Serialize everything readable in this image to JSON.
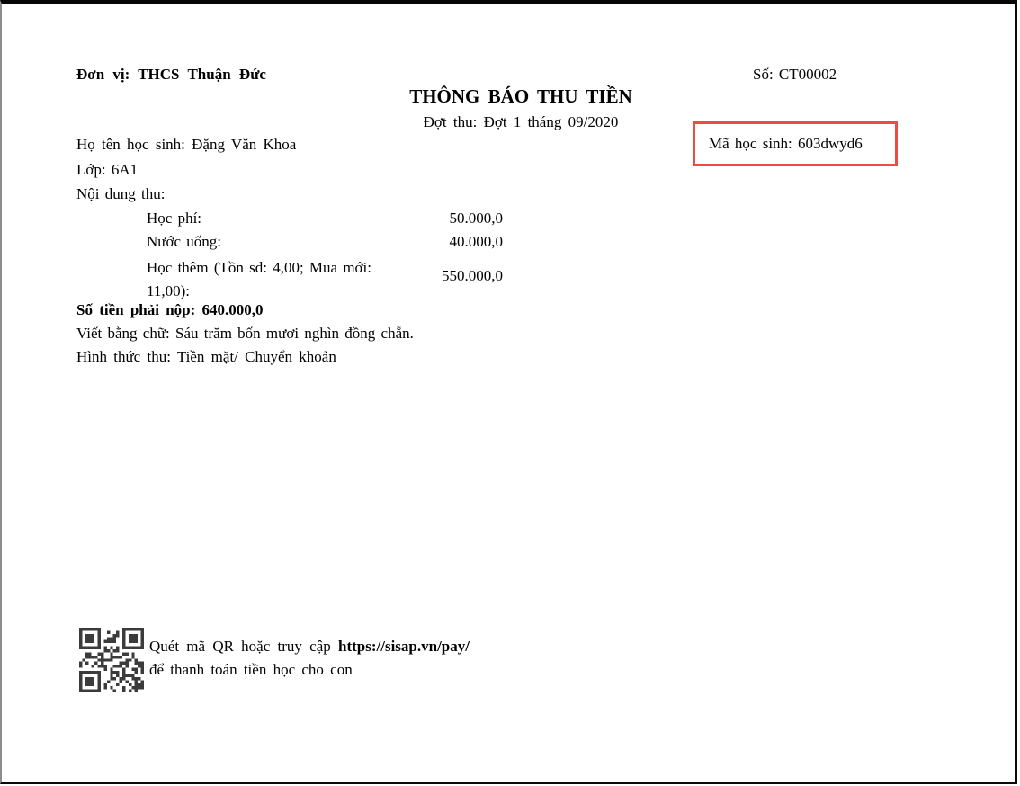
{
  "header": {
    "unit": "Đơn vị: THCS Thuận Đức",
    "doc_no": "Số: CT00002",
    "title": "THÔNG BÁO THU TIỀN",
    "period": "Đợt thu: Đợt 1 tháng 09/2020"
  },
  "student": {
    "name": "Họ tên học sinh: Đặng Văn Khoa",
    "code": "Mã học sinh: 603dwyd6",
    "class": "Lớp: 6A1"
  },
  "fees": {
    "section_label": "Nội dung thu:",
    "items": [
      {
        "label": "Học phí:",
        "amount": "50.000,0"
      },
      {
        "label": "Nước uống:",
        "amount": "40.000,0"
      },
      {
        "label": "Học thêm (Tồn sd: 4,00; Mua mới: 11,00):",
        "amount": "550.000,0"
      }
    ],
    "total": "Số tiền phải nộp: 640.000,0",
    "in_words": "Viết bằng chữ: Sáu trăm bốn mươi nghìn đồng chẵn.",
    "method": "Hình thức thu: Tiền mặt/ Chuyển khoản"
  },
  "footer": {
    "qr_icon": "qr-code",
    "line1_prefix": "Quét mã QR hoặc truy cập ",
    "link": "https://sisap.vn/pay/",
    "line2": "để thanh toán tiền học cho con"
  },
  "colors": {
    "highlight_red": "#f04a45",
    "qr_dark": "#3b3b3b"
  }
}
